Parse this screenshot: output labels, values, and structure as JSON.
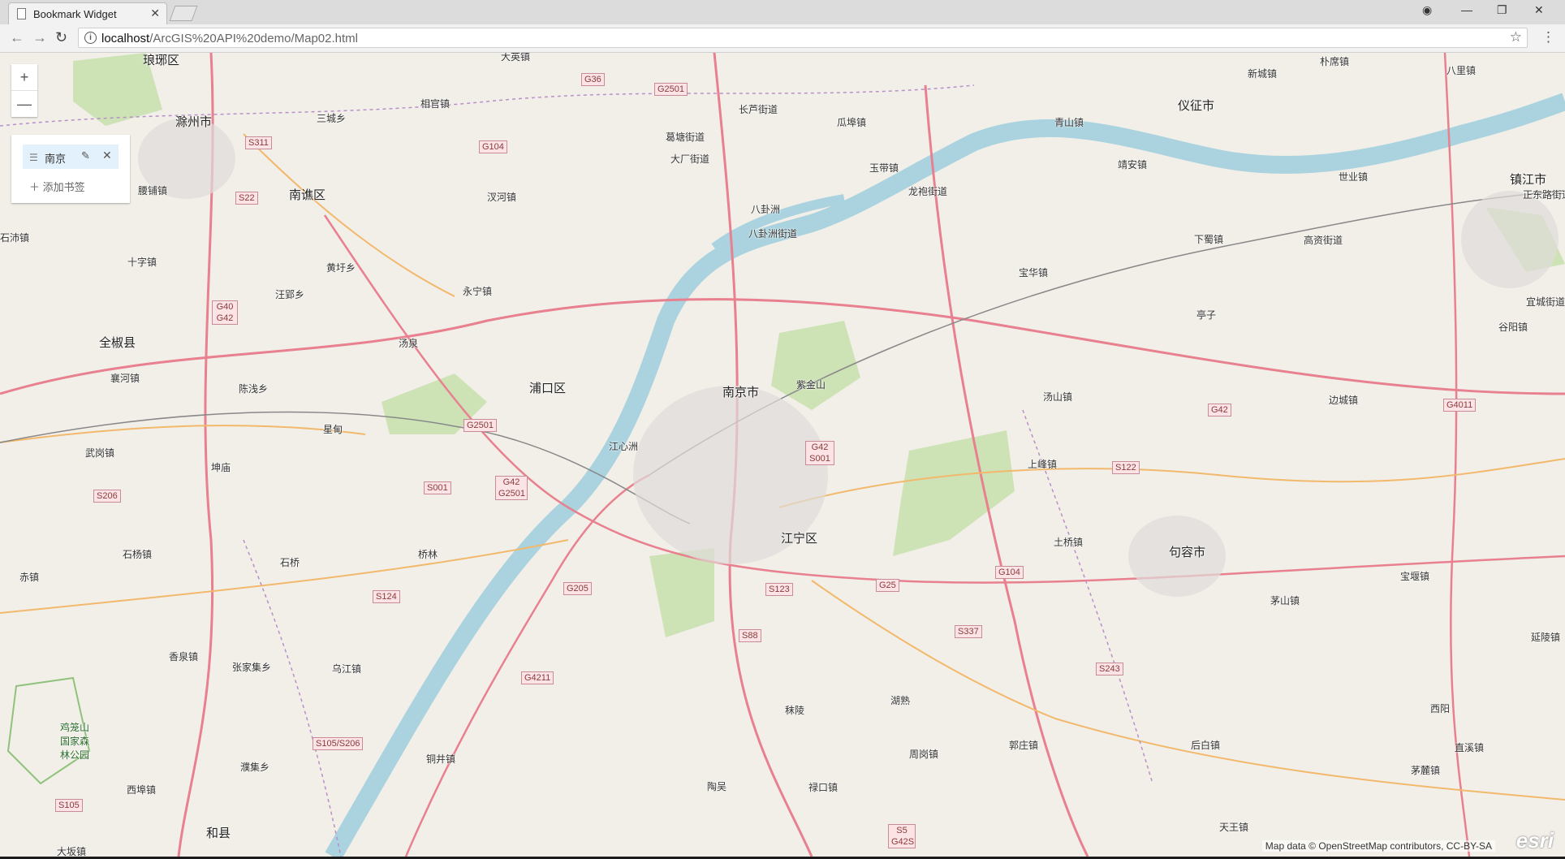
{
  "browser": {
    "tab_title": "Bookmark Widget",
    "url_host": "localhost",
    "url_path": "/ArcGIS%20API%20demo/Map02.html"
  },
  "widgets": {
    "zoom_in": "+",
    "zoom_out": "—",
    "bookmark_name": "南京",
    "add_bookmark": "添加书签"
  },
  "map": {
    "attribution": "Map data © OpenStreetMap contributors, CC-BY-SA",
    "logo": "esri",
    "places": [
      "琅琊区",
      "滁州市",
      "南谯区",
      "全椒县",
      "浦口区",
      "南京市",
      "江宁区",
      "仪征市",
      "镇江市",
      "句容市",
      "和县",
      "大英镇",
      "相官镇",
      "三城乡",
      "长芦街道",
      "瓜埠镇",
      "新城镇",
      "朴席镇",
      "八里镇",
      "青山镇",
      "高资街道",
      "八卦洲",
      "八卦洲街道",
      "龙袍街道",
      "玉带镇",
      "大厂街道",
      "葛塘街道",
      "汊河镇",
      "永宁镇",
      "汤泉",
      "黄圩乡",
      "汪郢乡",
      "十字镇",
      "石沛镇",
      "襄河镇",
      "陈浅乡",
      "星甸",
      "武岗镇",
      "坤庙",
      "石杨镇",
      "赤镇",
      "香泉镇",
      "张家集乡",
      "乌江镇",
      "桥林",
      "石桥",
      "铜井镇",
      "濮集乡",
      "西埠镇",
      "紫金山",
      "江心洲",
      "汤山镇",
      "上峰镇",
      "土桥镇",
      "宝华镇",
      "下蜀镇",
      "亭子",
      "边城镇",
      "谷阳镇",
      "宝堰镇",
      "茅山镇",
      "后白镇",
      "郭庄镇",
      "湖熟",
      "周岗镇",
      "秣陵",
      "禄口镇",
      "陶吴",
      "天王镇",
      "西阳",
      "直溪镇",
      "茅麓镇",
      "延陵镇",
      "世业镇",
      "靖安镇",
      "鸡笼山国家森林公园",
      "腰铺镇",
      "宜城街道",
      "正东路街道",
      "大坂镇"
    ],
    "shields": [
      "G36",
      "G2501",
      "G104",
      "S311",
      "S22",
      "G40 G42",
      "G42 G2501",
      "G42 S001",
      "G2501",
      "S001",
      "S206",
      "S124",
      "S105/S206",
      "S105",
      "G205",
      "G4211",
      "S88",
      "S123",
      "G25",
      "S337",
      "S243",
      "G4011",
      "S122",
      "G42",
      "G104 ",
      "S5 G42S"
    ]
  }
}
